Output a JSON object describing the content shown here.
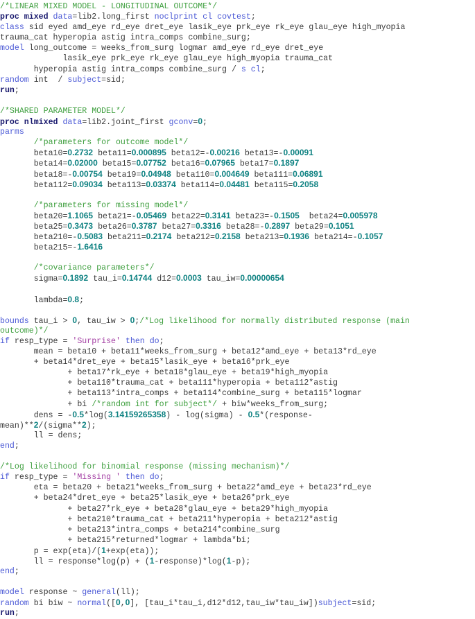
{
  "document": {
    "language": "SAS",
    "lines": [
      [
        [
          "comment",
          "/*LINEAR MIXED MODEL - LONGITUDINAL OUTCOME*/"
        ]
      ],
      [
        [
          "proc",
          "proc mixed"
        ],
        [
          "text",
          " "
        ],
        [
          "kw",
          "data"
        ],
        [
          "text",
          "=lib2.long_first "
        ],
        [
          "kw",
          "noclprint cl covtest"
        ],
        [
          "text",
          ";"
        ]
      ],
      [
        [
          "kw",
          "class"
        ],
        [
          "text",
          " sid eyed amd_eye rd_eye dret_eye lasik_eye prk_eye rk_eye glau_eye high_myopia"
        ]
      ],
      [
        [
          "text",
          "trauma_cat hyperopia astig intra_comps combine_surg;"
        ]
      ],
      [
        [
          "kw",
          "model"
        ],
        [
          "text",
          " long_outcome = weeks_from_surg logmar amd_eye rd_eye dret_eye"
        ]
      ],
      [
        [
          "text",
          "             lasik_eye prk_eye rk_eye glau_eye high_myopia trauma_cat"
        ]
      ],
      [
        [
          "text",
          "       hyperopia astig intra_comps combine_surg / "
        ],
        [
          "kw",
          "s cl"
        ],
        [
          "text",
          ";"
        ]
      ],
      [
        [
          "kw",
          "random"
        ],
        [
          "text",
          " int  / "
        ],
        [
          "kw",
          "subject"
        ],
        [
          "text",
          "=sid;"
        ]
      ],
      [
        [
          "proc",
          "run"
        ],
        [
          "text",
          ";"
        ]
      ],
      [
        [
          "text",
          ""
        ]
      ],
      [
        [
          "comment",
          "/*SHARED PARAMETER MODEL*/"
        ]
      ],
      [
        [
          "proc",
          "proc nlmixed"
        ],
        [
          "text",
          " "
        ],
        [
          "kw",
          "data"
        ],
        [
          "text",
          "=lib2.joint_first "
        ],
        [
          "kw",
          "gconv"
        ],
        [
          "text",
          "="
        ],
        [
          "num",
          "0"
        ],
        [
          "text",
          ";"
        ]
      ],
      [
        [
          "kw",
          "parms"
        ]
      ],
      [
        [
          "text",
          "       "
        ],
        [
          "comment",
          "/*parameters for outcome model*/"
        ]
      ],
      [
        [
          "text",
          "       beta10="
        ],
        [
          "num",
          "0.2732"
        ],
        [
          "text",
          " beta11="
        ],
        [
          "num",
          "0.000895"
        ],
        [
          "text",
          " beta12=-"
        ],
        [
          "num",
          "0.00216"
        ],
        [
          "text",
          " beta13=-"
        ],
        [
          "num",
          "0.00091"
        ]
      ],
      [
        [
          "text",
          "       beta14="
        ],
        [
          "num",
          "0.02000"
        ],
        [
          "text",
          " beta15="
        ],
        [
          "num",
          "0.07752"
        ],
        [
          "text",
          " beta16="
        ],
        [
          "num",
          "0.07965"
        ],
        [
          "text",
          " beta17="
        ],
        [
          "num",
          "0.1897"
        ]
      ],
      [
        [
          "text",
          "       beta18=-"
        ],
        [
          "num",
          "0.00754"
        ],
        [
          "text",
          " beta19="
        ],
        [
          "num",
          "0.04948"
        ],
        [
          "text",
          " beta110="
        ],
        [
          "num",
          "0.004649"
        ],
        [
          "text",
          " beta111="
        ],
        [
          "num",
          "0.06891"
        ]
      ],
      [
        [
          "text",
          "       beta112="
        ],
        [
          "num",
          "0.09034"
        ],
        [
          "text",
          " beta113="
        ],
        [
          "num",
          "0.03374"
        ],
        [
          "text",
          " beta114="
        ],
        [
          "num",
          "0.04481"
        ],
        [
          "text",
          " beta115="
        ],
        [
          "num",
          "0.2058"
        ]
      ],
      [
        [
          "text",
          ""
        ]
      ],
      [
        [
          "text",
          "       "
        ],
        [
          "comment",
          "/*parameters for missing model*/"
        ]
      ],
      [
        [
          "text",
          "       beta20="
        ],
        [
          "num",
          "1.1065"
        ],
        [
          "text",
          " beta21=-"
        ],
        [
          "num",
          "0.05469"
        ],
        [
          "text",
          " beta22="
        ],
        [
          "num",
          "0.3141"
        ],
        [
          "text",
          " beta23=-"
        ],
        [
          "num",
          "0.1505"
        ],
        [
          "text",
          "  beta24="
        ],
        [
          "num",
          "0.005978"
        ]
      ],
      [
        [
          "text",
          "       beta25="
        ],
        [
          "num",
          "0.3473"
        ],
        [
          "text",
          " beta26="
        ],
        [
          "num",
          "0.3787"
        ],
        [
          "text",
          " beta27="
        ],
        [
          "num",
          "0.3316"
        ],
        [
          "text",
          " beta28=-"
        ],
        [
          "num",
          "0.2897"
        ],
        [
          "text",
          " beta29="
        ],
        [
          "num",
          "0.1051"
        ]
      ],
      [
        [
          "text",
          "       beta210=-"
        ],
        [
          "num",
          "0.5083"
        ],
        [
          "text",
          " beta211="
        ],
        [
          "num",
          "0.2174"
        ],
        [
          "text",
          " beta212="
        ],
        [
          "num",
          "0.2158"
        ],
        [
          "text",
          " beta213="
        ],
        [
          "num",
          "0.1936"
        ],
        [
          "text",
          " beta214=-"
        ],
        [
          "num",
          "0.1057"
        ]
      ],
      [
        [
          "text",
          "       beta215=-"
        ],
        [
          "num",
          "1.6416"
        ]
      ],
      [
        [
          "text",
          ""
        ]
      ],
      [
        [
          "text",
          "       "
        ],
        [
          "comment",
          "/*covariance parameters*/"
        ]
      ],
      [
        [
          "text",
          "       sigma="
        ],
        [
          "num",
          "0.1892"
        ],
        [
          "text",
          " tau_i="
        ],
        [
          "num",
          "0.14744"
        ],
        [
          "text",
          " d12="
        ],
        [
          "num",
          "0.0003"
        ],
        [
          "text",
          " tau_iw="
        ],
        [
          "num",
          "0.00000654"
        ]
      ],
      [
        [
          "text",
          ""
        ]
      ],
      [
        [
          "text",
          "       lambda="
        ],
        [
          "num",
          "0.8"
        ],
        [
          "text",
          ";"
        ]
      ],
      [
        [
          "text",
          ""
        ]
      ],
      [
        [
          "kw",
          "bounds"
        ],
        [
          "text",
          " tau_i > "
        ],
        [
          "num",
          "0"
        ],
        [
          "text",
          ", tau_iw > "
        ],
        [
          "num",
          "0"
        ],
        [
          "text",
          ";"
        ],
        [
          "comment",
          "/*Log likelihood for normally distributed response (main"
        ]
      ],
      [
        [
          "comment",
          "outcome)*/"
        ]
      ],
      [
        [
          "kw",
          "if"
        ],
        [
          "text",
          " resp_type = "
        ],
        [
          "str",
          "'Surprise'"
        ],
        [
          "text",
          " "
        ],
        [
          "kw",
          "then do"
        ],
        [
          "text",
          ";"
        ]
      ],
      [
        [
          "text",
          "       mean = beta10 + beta11*weeks_from_surg + beta12*amd_eye + beta13*rd_eye"
        ]
      ],
      [
        [
          "text",
          "       + beta14*dret_eye + beta15*lasik_eye + beta16*prk_eye"
        ]
      ],
      [
        [
          "text",
          "              + beta17*rk_eye + beta18*glau_eye + beta19*high_myopia"
        ]
      ],
      [
        [
          "text",
          "              + beta110*trauma_cat + beta111*hyperopia + beta112*astig"
        ]
      ],
      [
        [
          "text",
          "              + beta113*intra_comps + beta114*combine_surg + beta115*logmar"
        ]
      ],
      [
        [
          "text",
          "              + bi "
        ],
        [
          "comment",
          "/*random int for subject*/"
        ],
        [
          "text",
          " + biw*weeks_from_surg;"
        ]
      ],
      [
        [
          "text",
          "       dens = -"
        ],
        [
          "num",
          "0.5"
        ],
        [
          "text",
          "*log("
        ],
        [
          "num",
          "3.14159265358"
        ],
        [
          "text",
          ") - log(sigma) - "
        ],
        [
          "num",
          "0.5"
        ],
        [
          "text",
          "*(response-"
        ]
      ],
      [
        [
          "text",
          "mean)**"
        ],
        [
          "num",
          "2"
        ],
        [
          "text",
          "/(sigma**"
        ],
        [
          "num",
          "2"
        ],
        [
          "text",
          ");"
        ]
      ],
      [
        [
          "text",
          "       ll = dens;"
        ]
      ],
      [
        [
          "kw",
          "end"
        ],
        [
          "text",
          ";"
        ]
      ],
      [
        [
          "text",
          ""
        ]
      ],
      [
        [
          "comment",
          "/*Log likelihood for binomial response (missing mechanism)*/"
        ]
      ],
      [
        [
          "kw",
          "if"
        ],
        [
          "text",
          " resp_type = "
        ],
        [
          "str",
          "'Missing '"
        ],
        [
          "text",
          " "
        ],
        [
          "kw",
          "then do"
        ],
        [
          "text",
          ";"
        ]
      ],
      [
        [
          "text",
          "       eta = beta20 + beta21*weeks_from_surg + beta22*amd_eye + beta23*rd_eye"
        ]
      ],
      [
        [
          "text",
          "       + beta24*dret_eye + beta25*lasik_eye + beta26*prk_eye"
        ]
      ],
      [
        [
          "text",
          "              + beta27*rk_eye + beta28*glau_eye + beta29*high_myopia"
        ]
      ],
      [
        [
          "text",
          "              + beta210*trauma_cat + beta211*hyperopia + beta212*astig"
        ]
      ],
      [
        [
          "text",
          "              + beta213*intra_comps + beta214*combine_surg"
        ]
      ],
      [
        [
          "text",
          "              + beta215*returned*logmar + lambda*bi;"
        ]
      ],
      [
        [
          "text",
          "       p = exp(eta)/("
        ],
        [
          "num",
          "1"
        ],
        [
          "text",
          "+exp(eta));"
        ]
      ],
      [
        [
          "text",
          "       ll = response*log(p) + ("
        ],
        [
          "num",
          "1"
        ],
        [
          "text",
          "-response)*log("
        ],
        [
          "num",
          "1"
        ],
        [
          "text",
          "-p);"
        ]
      ],
      [
        [
          "kw",
          "end"
        ],
        [
          "text",
          ";"
        ]
      ],
      [
        [
          "text",
          ""
        ]
      ],
      [
        [
          "kw",
          "model"
        ],
        [
          "text",
          " response ~ "
        ],
        [
          "kw",
          "general"
        ],
        [
          "text",
          "(ll);"
        ]
      ],
      [
        [
          "kw",
          "random"
        ],
        [
          "text",
          " bi biw ~ "
        ],
        [
          "kw",
          "normal"
        ],
        [
          "text",
          "(["
        ],
        [
          "num",
          "0"
        ],
        [
          "text",
          ","
        ],
        [
          "num",
          "0"
        ],
        [
          "text",
          "], [tau_i*tau_i,d12*d12,tau_iw*tau_iw])"
        ],
        [
          "kw",
          "subject"
        ],
        [
          "text",
          "=sid;"
        ]
      ],
      [
        [
          "proc",
          "run"
        ],
        [
          "text",
          ";"
        ]
      ]
    ]
  },
  "colors": {
    "text": "#3a3a3a",
    "comment": "#3f9f3f",
    "keyword": "#4b59d6",
    "proc_keyword": "#1a1a6e",
    "number": "#0f8282",
    "string": "#a33ea3",
    "background": "#ffffff"
  }
}
